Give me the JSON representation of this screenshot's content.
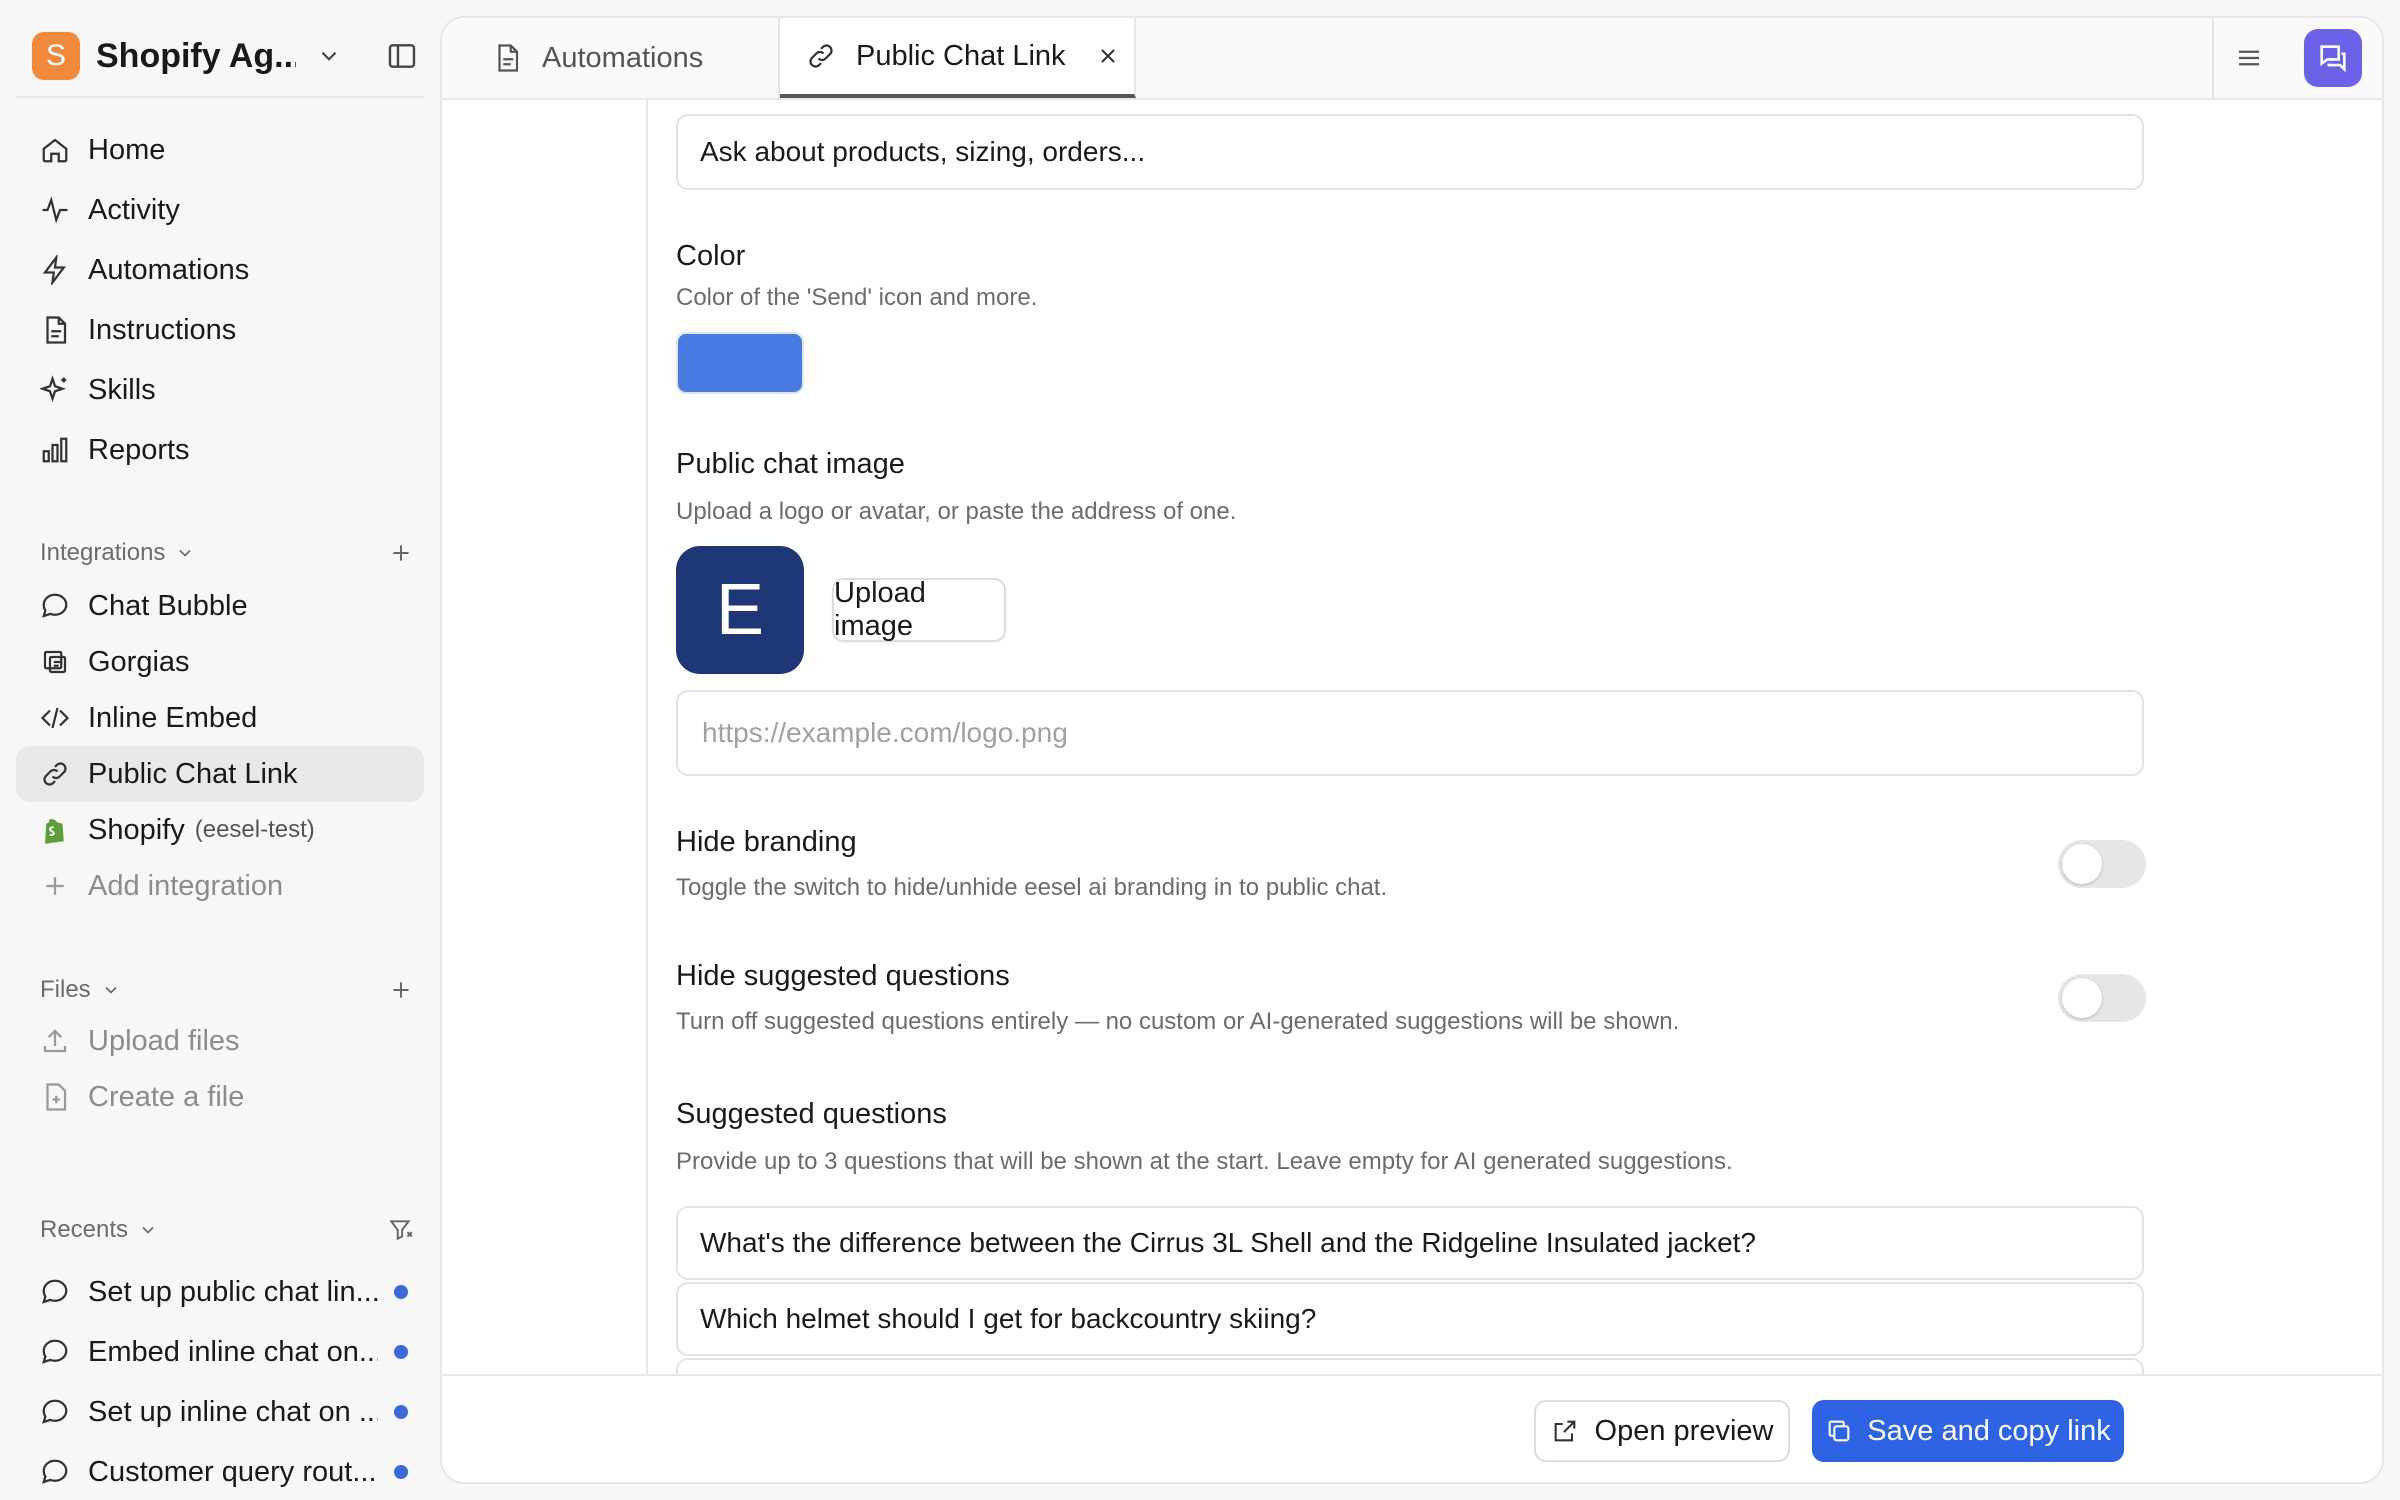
{
  "workspace": {
    "name": "Shopify Ag...",
    "logo_letter": "S",
    "logo_color": "#f08a3a"
  },
  "nav": [
    {
      "label": "Home",
      "icon": "home-icon"
    },
    {
      "label": "Activity",
      "icon": "activity-icon"
    },
    {
      "label": "Automations",
      "icon": "bolt-icon"
    },
    {
      "label": "Instructions",
      "icon": "document-icon"
    },
    {
      "label": "Skills",
      "icon": "sparkles-icon"
    },
    {
      "label": "Reports",
      "icon": "bar-chart-icon"
    }
  ],
  "integrations": {
    "title": "Integrations",
    "items": [
      {
        "label": "Chat Bubble",
        "icon": "chat-bubble-icon"
      },
      {
        "label": "Gorgias",
        "icon": "gorgias-icon"
      },
      {
        "label": "Inline Embed",
        "icon": "code-icon"
      },
      {
        "label": "Public Chat Link",
        "icon": "link-icon",
        "active": true
      },
      {
        "label": "Shopify",
        "sub": "(eesel-test)",
        "icon": "shopify-icon"
      },
      {
        "label": "Add integration",
        "icon": "plus-icon"
      }
    ]
  },
  "files": {
    "title": "Files",
    "items": [
      {
        "label": "Upload files",
        "icon": "upload-icon"
      },
      {
        "label": "Create a file",
        "icon": "file-plus-icon"
      }
    ]
  },
  "recents": {
    "title": "Recents",
    "items": [
      {
        "label": "Set up public chat lin..."
      },
      {
        "label": "Embed inline chat on..."
      },
      {
        "label": "Set up inline chat on ..."
      },
      {
        "label": "Customer query rout..."
      }
    ]
  },
  "tabs": [
    {
      "label": "Automations"
    },
    {
      "label": "Public Chat Link",
      "active": true
    }
  ],
  "form": {
    "placeholder_value": "Ask about products, sizing, orders...",
    "color": {
      "label": "Color",
      "desc": "Color of the 'Send' icon and more.",
      "value": "#4a7be3"
    },
    "image": {
      "label": "Public chat image",
      "desc": "Upload a logo or avatar, or paste the address of one.",
      "avatar_letter": "E",
      "upload_label": "Upload image",
      "url_placeholder": "https://example.com/logo.png"
    },
    "hide_branding": {
      "label": "Hide branding",
      "desc": "Toggle the switch to hide/unhide eesel ai branding in to public chat.",
      "on": false
    },
    "hide_suggested": {
      "label": "Hide suggested questions",
      "desc": "Turn off suggested questions entirely — no custom or AI-generated suggestions will be shown.",
      "on": false
    },
    "suggested": {
      "label": "Suggested questions",
      "desc": "Provide up to 3 questions that will be shown at the start. Leave empty for AI generated suggestions.",
      "questions": [
        "What's the difference between the Cirrus 3L Shell and the Ridgeline Insulated jacket?",
        "Which helmet should I get for backcountry skiing?"
      ]
    }
  },
  "footer": {
    "preview_label": "Open preview",
    "save_label": "Save and copy link"
  },
  "colors": {
    "accent": "#2e63e6",
    "chat_button": "#6c62e8",
    "unread_dot": "#3d6ad8"
  }
}
